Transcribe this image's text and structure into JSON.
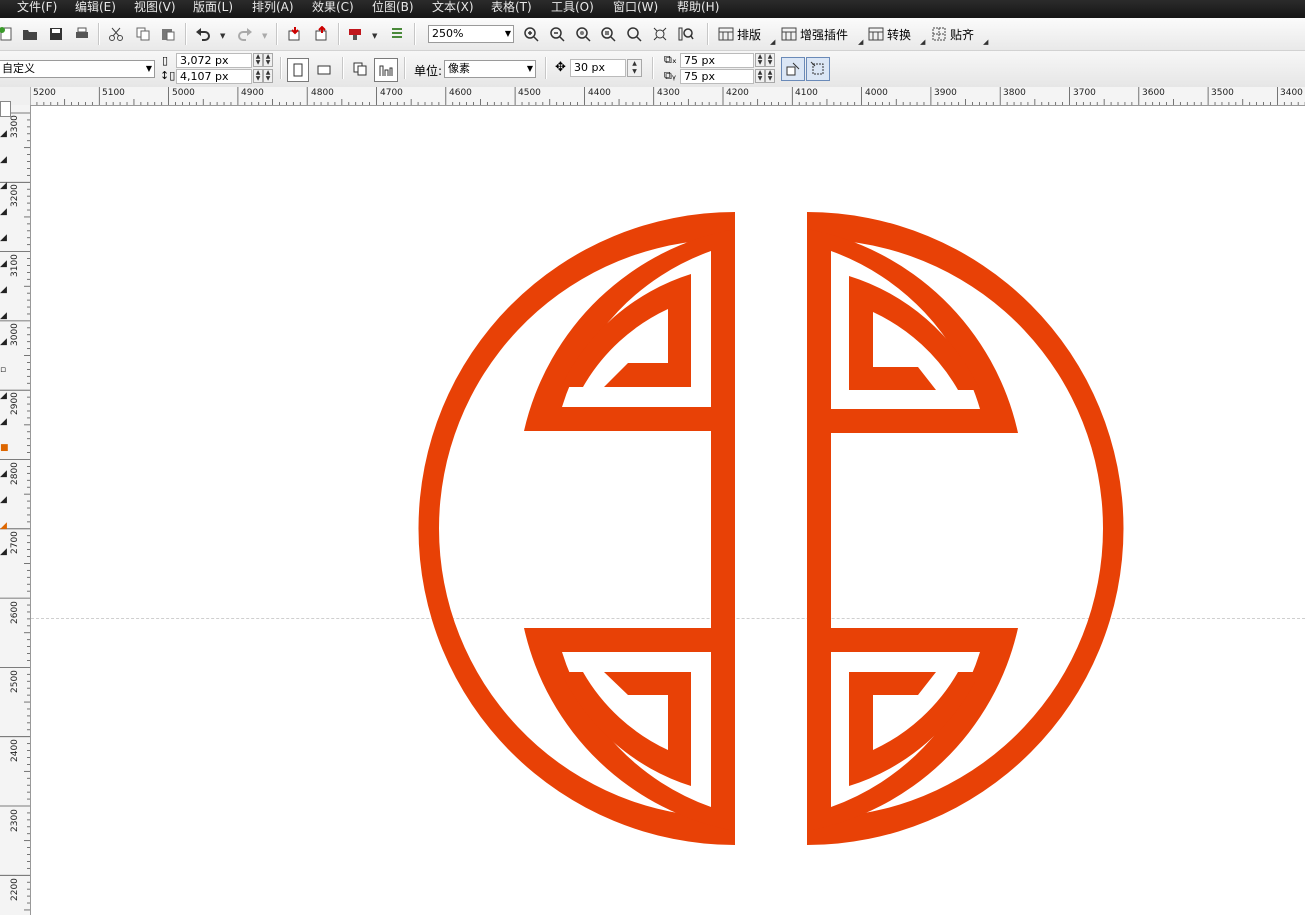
{
  "menubar": {
    "items": [
      "文件(F)",
      "编辑(E)",
      "视图(V)",
      "版面(L)",
      "排列(A)",
      "效果(C)",
      "位图(B)",
      "文本(X)",
      "表格(T)",
      "工具(O)",
      "窗口(W)",
      "帮助(H)"
    ]
  },
  "toolbar": {
    "icons": [
      "new-document-icon",
      "open-icon",
      "save-icon",
      "print-icon",
      "cut-icon",
      "copy-icon",
      "paste-icon",
      "undo-icon",
      "redo-icon",
      "import-icon",
      "export-icon",
      "application-launcher-icon",
      "welcome-screen-icon",
      "zoom-in-icon",
      "zoom-out-icon",
      "zoom-selected-icon",
      "zoom-all-objects-icon",
      "zoom-page-icon",
      "zoom-width-icon"
    ],
    "zoom_value": "250%",
    "plugins": [
      {
        "label": "排版",
        "icon": "layout-plugin-icon"
      },
      {
        "label": "增强插件",
        "icon": "enhance-plugin-icon"
      },
      {
        "label": "转换",
        "icon": "convert-plugin-icon"
      },
      {
        "label": "贴齐",
        "icon": "snap-plugin-icon"
      }
    ]
  },
  "property_bar": {
    "page_preset": "自定义",
    "width": "3,072 px",
    "height": "4,107 px",
    "units_label": "单位:",
    "units_value": "像素",
    "nudge": "30 px",
    "dup_x": "75 px",
    "dup_y": "75 px"
  },
  "ruler": {
    "top": [
      "5200",
      "5100",
      "5000",
      "4900",
      "4800",
      "4700",
      "4600",
      "4500",
      "4400",
      "4300",
      "4200",
      "4100",
      "4000",
      "3900",
      "3800",
      "3700",
      "3600",
      "3500",
      "3400"
    ],
    "left": [
      "3300",
      "3200",
      "3100",
      "3000",
      "2900",
      "2800",
      "2700",
      "2600",
      "2500",
      "2400",
      "2300",
      "2200"
    ]
  },
  "artwork": {
    "color": "#e84106",
    "description_free": true
  }
}
